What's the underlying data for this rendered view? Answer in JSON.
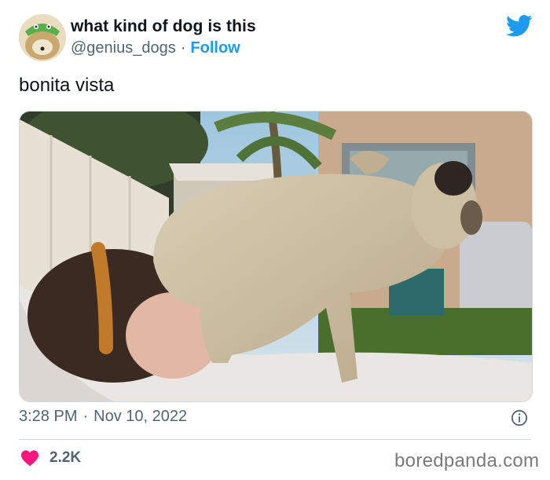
{
  "tweet": {
    "display_name": "what kind of dog is this",
    "handle": "@genius_dogs",
    "separator": "·",
    "follow_label": "Follow",
    "text": "bonita vista",
    "time": "3:28 PM",
    "date": "Nov 10, 2022",
    "likes": "2.2K"
  },
  "watermark": "boredpanda.com",
  "icons": {
    "brand": "twitter-bird-icon",
    "info": "info-icon",
    "like": "heart-icon"
  },
  "colors": {
    "accent": "#1d9bf0",
    "heart": "#f91880",
    "muted_text": "#536471",
    "text": "#0f1419",
    "border": "#cfd9de"
  }
}
